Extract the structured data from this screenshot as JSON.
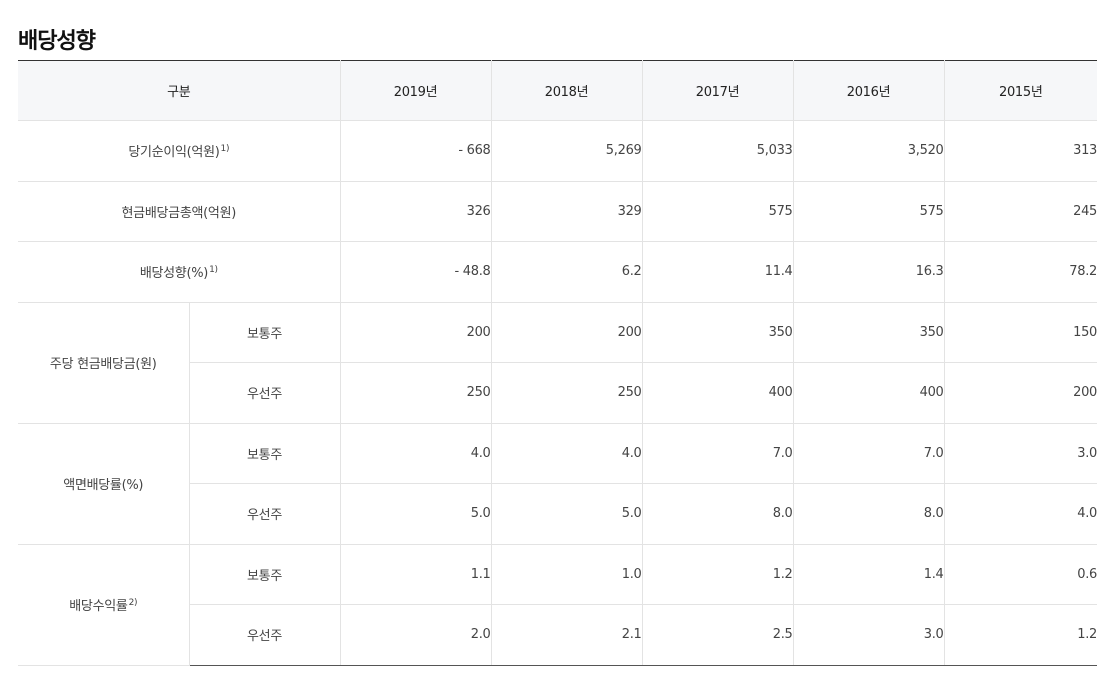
{
  "page": {
    "title": "배당성향"
  },
  "table": {
    "header": {
      "category": "구분",
      "years": [
        "2019년",
        "2018년",
        "2017년",
        "2016년",
        "2015년"
      ]
    },
    "rows": {
      "net_income": {
        "label": "당기순이익(억원)",
        "note": "1)",
        "values": [
          "- 668",
          "5,269",
          "5,033",
          "3,520",
          "313"
        ]
      },
      "cash_dividend_total": {
        "label": "현금배당금총액(억원)",
        "values": [
          "326",
          "329",
          "575",
          "575",
          "245"
        ]
      },
      "payout_ratio": {
        "label": "배당성향(%)",
        "note": "1)",
        "values": [
          "- 48.8",
          "6.2",
          "11.4",
          "16.3",
          "78.2"
        ]
      }
    },
    "groups": {
      "dps": {
        "label": "주당 현금배당금(원)",
        "common": {
          "label": "보통주",
          "values": [
            "200",
            "200",
            "350",
            "350",
            "150"
          ]
        },
        "preferred": {
          "label": "우선주",
          "values": [
            "250",
            "250",
            "400",
            "400",
            "200"
          ]
        }
      },
      "par_yield": {
        "label": "액면배당률(%)",
        "common": {
          "label": "보통주",
          "values": [
            "4.0",
            "4.0",
            "7.0",
            "7.0",
            "3.0"
          ]
        },
        "preferred": {
          "label": "우선주",
          "values": [
            "5.0",
            "5.0",
            "8.0",
            "8.0",
            "4.0"
          ]
        }
      },
      "dividend_yield": {
        "label": "배당수익률",
        "note": "2)",
        "common": {
          "label": "보통주",
          "values": [
            "1.1",
            "1.0",
            "1.2",
            "1.4",
            "0.6"
          ]
        },
        "preferred": {
          "label": "우선주",
          "values": [
            "2.0",
            "2.1",
            "2.5",
            "3.0",
            "1.2"
          ]
        }
      }
    }
  }
}
